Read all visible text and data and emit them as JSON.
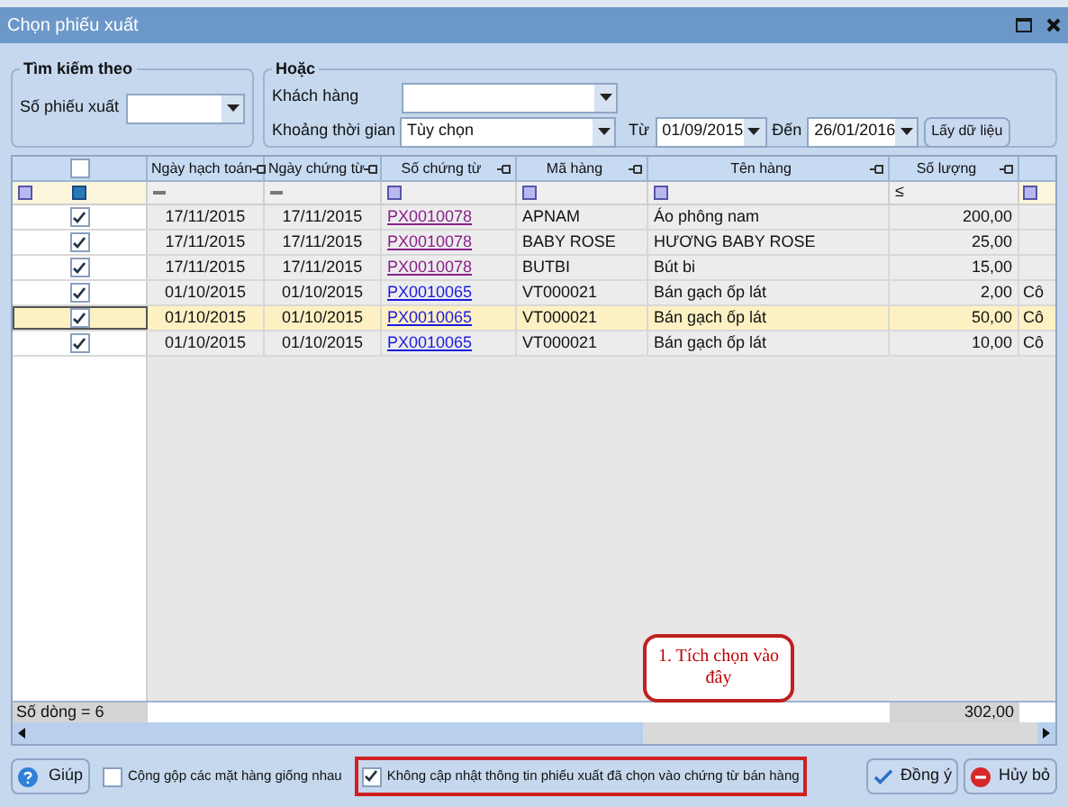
{
  "window": {
    "title": "Chọn phiếu xuất"
  },
  "search_by": {
    "title": "Tìm kiếm theo",
    "label": "Số phiếu xuất"
  },
  "or_group": {
    "title": "Hoặc",
    "customer_label": "Khách hàng",
    "period_label": "Khoảng thời gian",
    "period_value": "Tùy chọn",
    "from_label": "Từ",
    "from_value": "01/09/2015",
    "to_label": "Đến",
    "to_value": "26/01/2016",
    "fetch_button": "Lấy dữ liệu"
  },
  "table": {
    "select_all_checked": false,
    "columns": [
      "Ngày hạch toán",
      "Ngày chứng từ",
      "Số chứng từ",
      "Mã hàng",
      "Tên hàng",
      "Số lượng"
    ],
    "quantity_filter": "≤",
    "rows": [
      {
        "checked": true,
        "selected": false,
        "visited": true,
        "posting_date": "17/11/2015",
        "doc_date": "17/11/2015",
        "doc_no": "PX0010078",
        "item_code": "APNAM",
        "item_name": "Áo phông nam",
        "quantity": "200,00",
        "column_8": ""
      },
      {
        "checked": true,
        "selected": false,
        "visited": true,
        "posting_date": "17/11/2015",
        "doc_date": "17/11/2015",
        "doc_no": "PX0010078",
        "item_code": "BABY ROSE",
        "item_name": "HƯƠNG BABY ROSE",
        "quantity": "25,00",
        "column_8": ""
      },
      {
        "checked": true,
        "selected": false,
        "visited": true,
        "posting_date": "17/11/2015",
        "doc_date": "17/11/2015",
        "doc_no": "PX0010078",
        "item_code": "BUTBI",
        "item_name": "Bút bi",
        "quantity": "15,00",
        "column_8": ""
      },
      {
        "checked": true,
        "selected": false,
        "visited": false,
        "posting_date": "01/10/2015",
        "doc_date": "01/10/2015",
        "doc_no": "PX0010065",
        "item_code": "VT000021",
        "item_name": "Bán gạch ốp lát",
        "quantity": "2,00",
        "column_8": "Cô"
      },
      {
        "checked": true,
        "selected": true,
        "visited": false,
        "posting_date": "01/10/2015",
        "doc_date": "01/10/2015",
        "doc_no": "PX0010065",
        "item_code": "VT000021",
        "item_name": "Bán gạch ốp lát",
        "quantity": "50,00",
        "column_8": "Cô"
      },
      {
        "checked": true,
        "selected": false,
        "visited": false,
        "posting_date": "01/10/2015",
        "doc_date": "01/10/2015",
        "doc_no": "PX0010065",
        "item_code": "VT000021",
        "item_name": "Bán gạch ốp lát",
        "quantity": "10,00",
        "column_8": "Cô"
      }
    ],
    "row_count": "Số dòng = 6",
    "total_quantity": "302,00"
  },
  "callout": "1. Tích chọn vào đây",
  "footer": {
    "help_button": "Giúp",
    "options": [
      {
        "label": "Cộng gộp các mặt hàng giống nhau",
        "checked": false,
        "highlighted": false
      },
      {
        "label": "Không cập nhật thông tin phiếu xuất đã chọn vào chứng từ bán hàng",
        "checked": true,
        "highlighted": true
      }
    ],
    "ok_button": "Đồng ý",
    "cancel_button": "Hủy bỏ"
  }
}
